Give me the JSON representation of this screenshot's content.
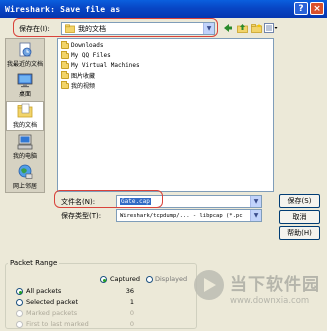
{
  "window": {
    "title": "Wireshark: Save file as",
    "help_label": "?",
    "close_label": "×"
  },
  "save_in": {
    "label": "保存在(I):",
    "value": "我的文档"
  },
  "places": [
    {
      "label": "我最近的文档",
      "icon": "recent-documents-icon"
    },
    {
      "label": "桌面",
      "icon": "desktop-icon"
    },
    {
      "label": "我的文档",
      "icon": "my-documents-icon"
    },
    {
      "label": "我的电脑",
      "icon": "my-computer-icon"
    },
    {
      "label": "网上邻居",
      "icon": "network-places-icon"
    }
  ],
  "files": [
    {
      "name": "Downloads"
    },
    {
      "name": "My QQ Files"
    },
    {
      "name": "My Virtual Machines"
    },
    {
      "name": "图片收藏"
    },
    {
      "name": "我的视频"
    }
  ],
  "filename": {
    "label": "文件名(N):",
    "value": "Gate.cap"
  },
  "save_type": {
    "label": "保存类型(T):",
    "value": "Wireshark/tcpdump/... - libpcap (*.pc"
  },
  "buttons": {
    "save": "保存(S)",
    "cancel": "取消",
    "help": "帮助(H)"
  },
  "packet_range": {
    "title": "Packet Range",
    "captured_label": "Captured",
    "displayed_label": "Displayed",
    "rows": [
      {
        "label": "All packets",
        "captured": "36"
      },
      {
        "label": "Selected packet",
        "captured": "1"
      },
      {
        "label": "Marked packets",
        "captured": "0"
      },
      {
        "label": "First to last marked",
        "captured": "0"
      }
    ]
  },
  "watermark": {
    "text": "当下软件园",
    "url": "www.downxia.com"
  }
}
